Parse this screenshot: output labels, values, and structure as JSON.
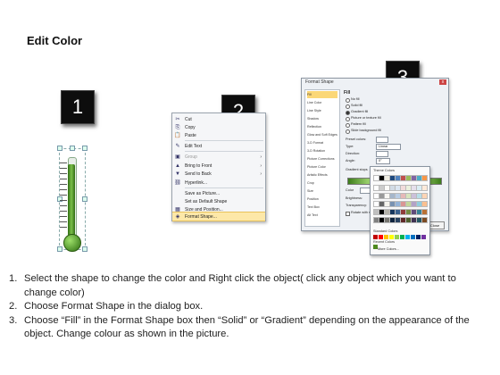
{
  "title": "Edit Color",
  "badges": [
    "1",
    "2",
    "3"
  ],
  "context_menu": {
    "items": [
      {
        "icon": "✂",
        "label": "Cut",
        "arrow": "",
        "disabled": false
      },
      {
        "icon": "⎘",
        "label": "Copy",
        "arrow": "",
        "disabled": false
      },
      {
        "icon": "📋",
        "label": "Paste",
        "arrow": "",
        "disabled": false
      },
      {
        "icon": "✎",
        "label": "Edit Text",
        "arrow": "",
        "disabled": false
      },
      {
        "icon": "▣",
        "label": "Group",
        "arrow": "›",
        "disabled": true
      },
      {
        "icon": "▲",
        "label": "Bring to Front",
        "arrow": "›",
        "disabled": false
      },
      {
        "icon": "▼",
        "label": "Send to Back",
        "arrow": "›",
        "disabled": false
      },
      {
        "icon": "⛓",
        "label": "Hyperlink...",
        "arrow": "",
        "disabled": false
      },
      {
        "icon": "",
        "label": "Save as Picture...",
        "arrow": "",
        "disabled": false
      },
      {
        "icon": "",
        "label": "Set as Default Shape",
        "arrow": "",
        "disabled": false
      },
      {
        "icon": "▦",
        "label": "Size and Position...",
        "arrow": "",
        "disabled": false
      },
      {
        "icon": "◈",
        "label": "Format Shape...",
        "arrow": "",
        "disabled": false
      }
    ]
  },
  "format_dialog": {
    "title": "Format Shape",
    "close": "x",
    "left_items": [
      "Fill",
      "Line Color",
      "Line Style",
      "Shadow",
      "Reflection",
      "Glow and Soft Edges",
      "3-D Format",
      "3-D Rotation",
      "Picture Corrections",
      "Picture Color",
      "Artistic Effects",
      "Crop",
      "Size",
      "Position",
      "Text Box",
      "Alt Text"
    ],
    "section": "Fill",
    "options": [
      "No fill",
      "Solid fill",
      "Gradient fill",
      "Picture or texture fill",
      "Pattern fill",
      "Slide background fill"
    ],
    "preset_label": "Preset colors:",
    "type_label": "Type:",
    "type_value": "Linear",
    "direction_label": "Direction:",
    "angle_label": "Angle:",
    "angle_value": "0°",
    "stops_label": "Gradient stops",
    "color_label": "Color",
    "position_label": "Position:",
    "position_value": "5%",
    "brightness_label": "Brightness:",
    "transparency_label": "Transparency:",
    "rotate_label": "Rotate with shape",
    "close_button": "Close"
  },
  "color_picker": {
    "theme_label": "Theme Colors",
    "standard_label": "Standard Colors",
    "recent_label": "Recent Colors",
    "more_label": "More Colors...",
    "theme_top": [
      "#ffffff",
      "#000000",
      "#eeece1",
      "#1f497d",
      "#4f81bd",
      "#c0504d",
      "#9bbb59",
      "#8064a2",
      "#4bacc6",
      "#f79646"
    ],
    "standard": [
      "#c00000",
      "#ff0000",
      "#ffc000",
      "#ffff00",
      "#92d050",
      "#00b050",
      "#00b0f0",
      "#0070c0",
      "#002060",
      "#7030a0"
    ],
    "recent": [
      "#4e8a1e"
    ]
  },
  "steps": [
    {
      "num": "1.",
      "text": "Select the shape to change the color and Right click the object( click any object which you want to change color)"
    },
    {
      "num": "2.",
      "text": "Choose Format Shape in the dialog box."
    },
    {
      "num": "3.",
      "text": "Choose “Fill” in the Format Shape box then “Solid” or “Gradient” depending on the appearance of the object. Change colour as shown in the picture."
    }
  ]
}
